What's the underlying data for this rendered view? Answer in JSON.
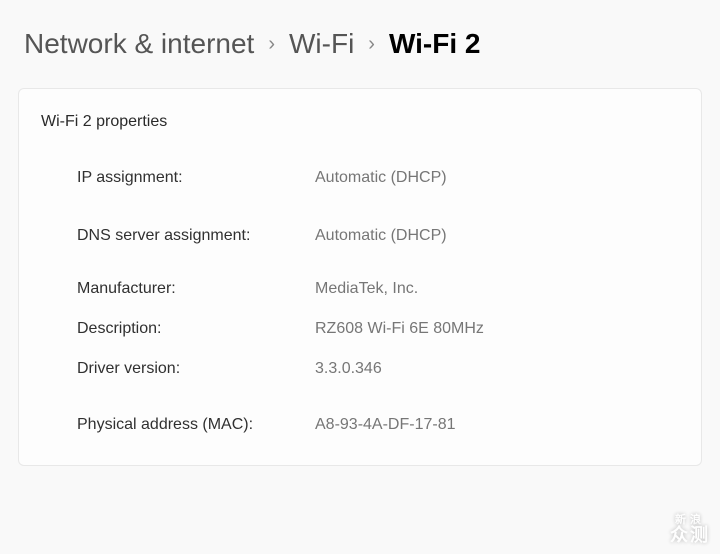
{
  "breadcrumb": {
    "items": [
      {
        "label": "Network & internet",
        "current": false
      },
      {
        "label": "Wi-Fi",
        "current": false
      },
      {
        "label": "Wi-Fi 2",
        "current": true
      }
    ],
    "separator": "›"
  },
  "card": {
    "title": "Wi-Fi 2 properties",
    "sections": [
      [
        {
          "label": "IP assignment:",
          "value": "Automatic (DHCP)"
        }
      ],
      [
        {
          "label": "DNS server assignment:",
          "value": "Automatic (DHCP)"
        }
      ],
      [
        {
          "label": "Manufacturer:",
          "value": "MediaTek, Inc."
        },
        {
          "label": "Description:",
          "value": "RZ608 Wi-Fi 6E 80MHz"
        },
        {
          "label": "Driver version:",
          "value": "3.3.0.346"
        }
      ],
      [
        {
          "label": "Physical address (MAC):",
          "value": "A8-93-4A-DF-17-81"
        }
      ]
    ]
  },
  "watermark": {
    "top": "新浪",
    "bottom": "众测"
  }
}
